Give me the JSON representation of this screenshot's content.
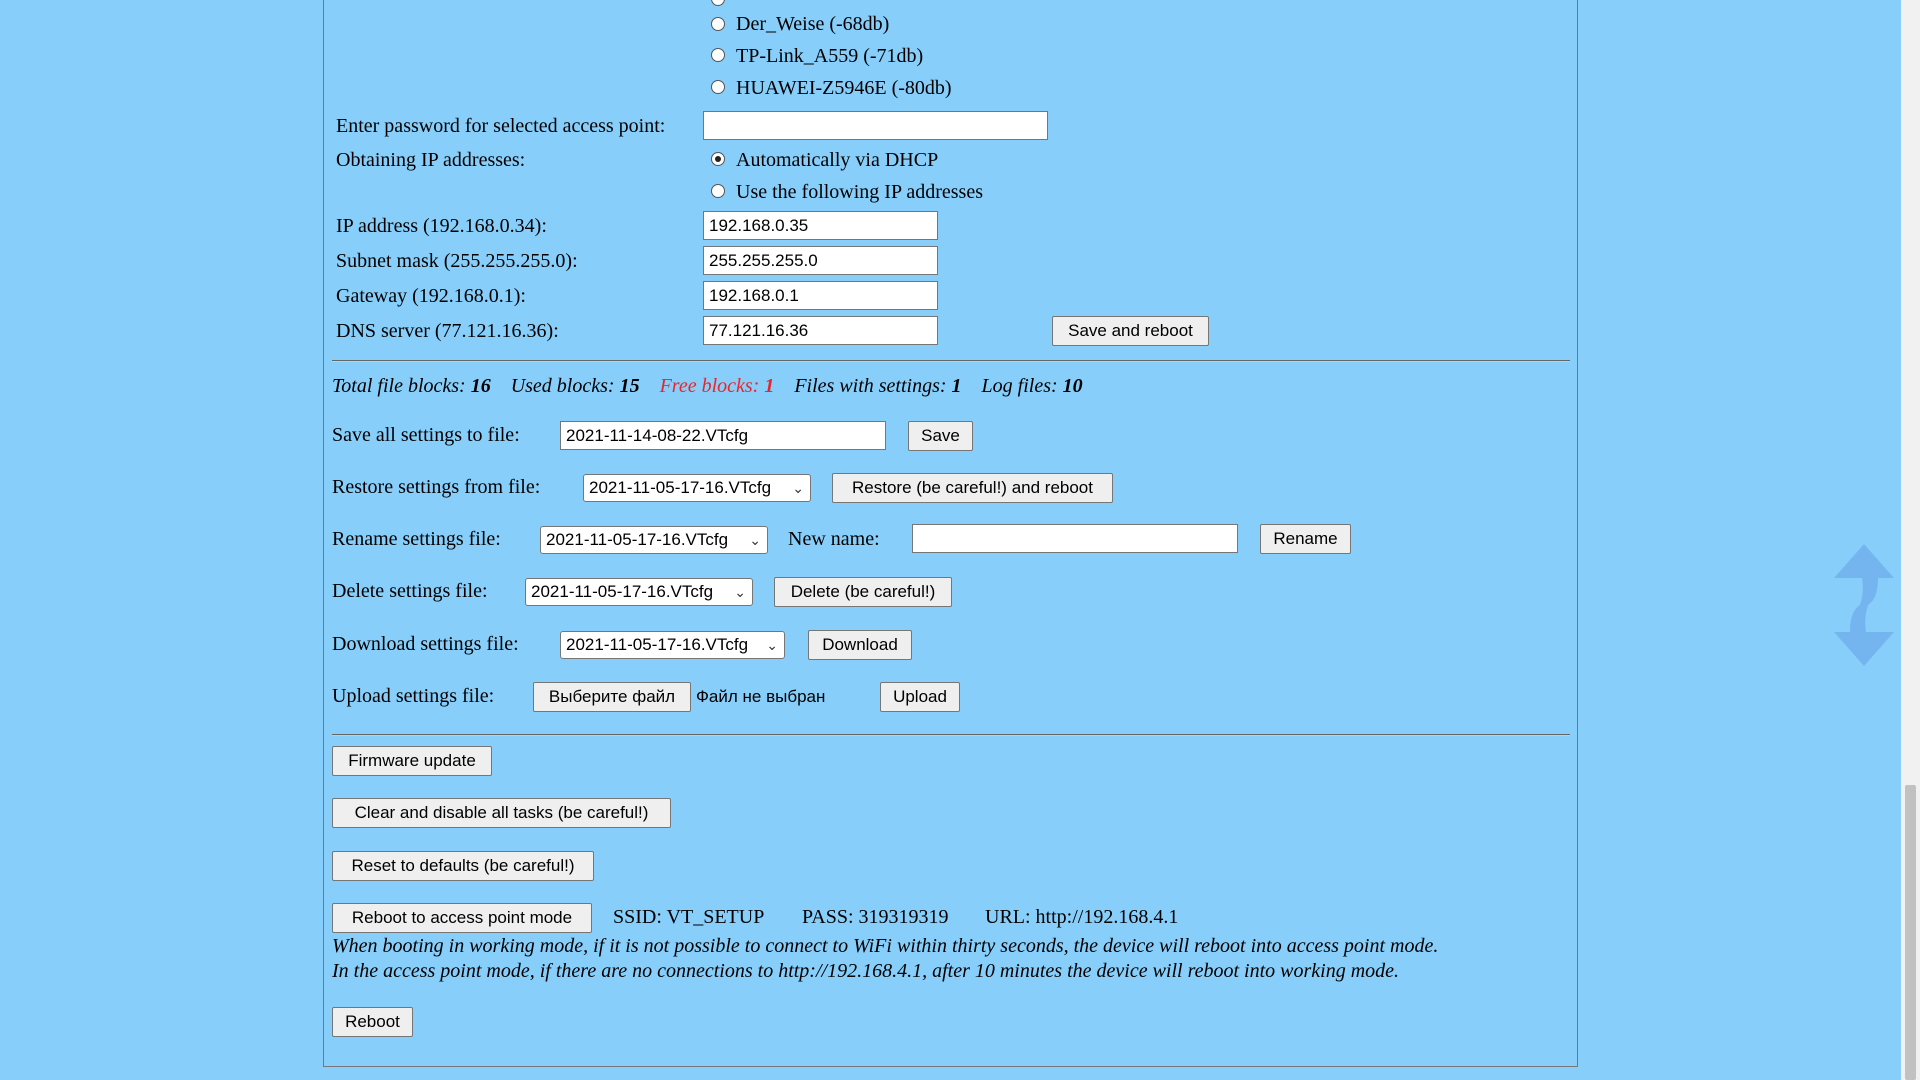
{
  "wifi": {
    "networks": [
      {
        "label": "Der_Weise (-68db)",
        "selected": false
      },
      {
        "label": "TP-Link_A559 (-71db)",
        "selected": false
      },
      {
        "label": "HUAWEI-Z5946E (-80db)",
        "selected": false
      }
    ],
    "password_label": "Enter password for selected access point:",
    "password_value": ""
  },
  "ip": {
    "obtaining_label": "Obtaining IP addresses:",
    "dhcp_label": "Automatically via DHCP",
    "dhcp_selected": true,
    "static_label": "Use the following IP addresses",
    "ip_label": "IP address (192.168.0.34):",
    "ip_value": "192.168.0.35",
    "mask_label": "Subnet mask (255.255.255.0):",
    "mask_value": "255.255.255.0",
    "gateway_label": "Gateway (192.168.0.1):",
    "gateway_value": "192.168.0.1",
    "dns_label": "DNS server (77.121.16.36):",
    "dns_value": "77.121.16.36",
    "save_reboot_label": "Save and reboot"
  },
  "stats": {
    "total_label": "Total file blocks:",
    "total_value": "16",
    "used_label": "Used blocks:",
    "used_value": "15",
    "free_label": "Free blocks:",
    "free_value": "1",
    "settings_label": "Files with settings:",
    "settings_value": "1",
    "log_label": "Log files:",
    "log_value": "10"
  },
  "files": {
    "save_label": "Save all settings to file:",
    "save_value": "2021-11-14-08-22.VTcfg",
    "save_button": "Save",
    "restore_label": "Restore settings from file:",
    "restore_select": "2021-11-05-17-16.VTcfg",
    "restore_button": "Restore (be careful!) and reboot",
    "rename_label": "Rename settings file:",
    "rename_select": "2021-11-05-17-16.VTcfg",
    "new_name_label": "New name:",
    "new_name_value": "",
    "rename_button": "Rename",
    "delete_label": "Delete settings file:",
    "delete_select": "2021-11-05-17-16.VTcfg",
    "delete_button": "Delete (be careful!)",
    "download_label": "Download settings file:",
    "download_select": "2021-11-05-17-16.VTcfg",
    "download_button": "Download",
    "upload_label": "Upload settings file:",
    "choose_button": "Выберите файл",
    "no_file_text": "Файл не выбран",
    "upload_button": "Upload"
  },
  "system": {
    "firmware_button": "Firmware update",
    "clear_button": "Clear and disable all tasks (be careful!)",
    "reset_button": "Reset to defaults (be careful!)",
    "ap_button": "Reboot to access point mode",
    "ssid_text": "SSID: VT_SETUP",
    "pass_text": "PASS: 319319319",
    "url_text": "URL: http://192.168.4.1",
    "note_line1": "When booting in working mode, if it is not possible to connect to WiFi within thirty seconds, the device will reboot into access point mode.",
    "note_line2": "In the access point mode, if there are no connections to http://192.168.4.1, after 10 minutes the device will reboot into working mode.",
    "reboot_button": "Reboot"
  },
  "icons": {
    "select_chevron": "chevron-down-icon",
    "scroll_arrows": "up-down-arrows-icon"
  },
  "colors": {
    "background": "#87CEFA",
    "free_blocks": "#e8262a"
  }
}
